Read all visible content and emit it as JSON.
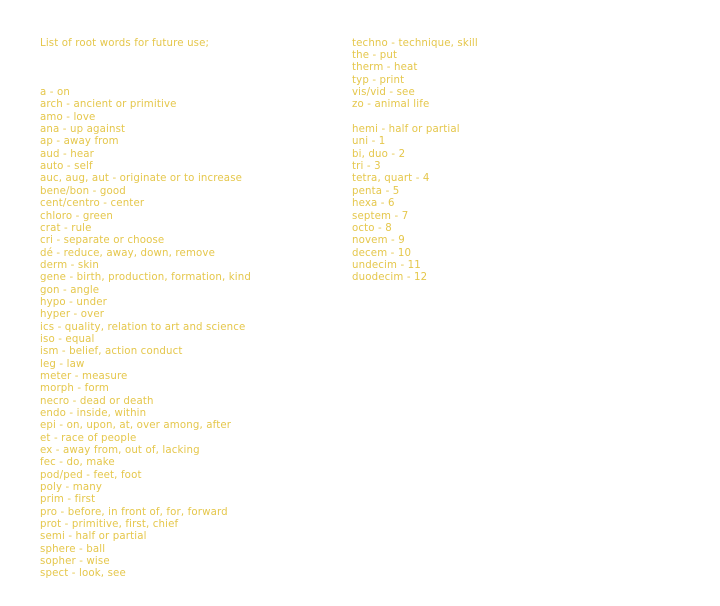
{
  "slide": {
    "background_color": "#ffffff",
    "text_color": "#e5c74c",
    "heading": "List of root words for future use;",
    "left_column": [
      "",
      "a - on",
      "arch - ancient or primitive",
      "amo - love",
      "ana - up against",
      "ap - away from",
      "aud - hear",
      "auto - self",
      "auc, aug, aut - originate or to increase",
      "bene/bon - good",
      "cent/centro - center",
      "chloro - green",
      "crat - rule",
      "cri - separate or choose",
      "dé - reduce, away, down, remove",
      "derm - skin",
      "gene - birth, production, formation, kind",
      "gon - angle",
      "hypo - under",
      "hyper - over",
      "ics - quality, relation to art and science",
      "iso - equal",
      "ism - belief, action conduct",
      "leg - law",
      "meter - measure",
      "morph - form",
      "necro - dead or death",
      "endo - inside, within",
      "epi - on, upon, at, over among, after",
      "et - race of people",
      "ex - away from, out of, lacking",
      "fec - do, make",
      "pod/ped - feet, foot",
      "poly - many",
      "prim - first",
      "pro - before, in front of, for, forward",
      "prot - primitive, first, chief",
      "semi - half or partial",
      "sphere - ball",
      "sopher - wise",
      "spect - look, see"
    ],
    "right_column": [
      "techno - technique, skill",
      "the - put",
      "therm - heat",
      "typ - print",
      "vis/vid - see",
      "zo - animal life",
      "",
      "hemi - half or partial",
      "uni - 1",
      "bi, duo - 2",
      "tri - 3",
      "tetra, quart - 4",
      "penta - 5",
      "hexa - 6",
      "septem - 7",
      "octo - 8",
      "novem - 9",
      "decem - 10",
      "undecim - 11",
      "duodecim - 12"
    ]
  }
}
